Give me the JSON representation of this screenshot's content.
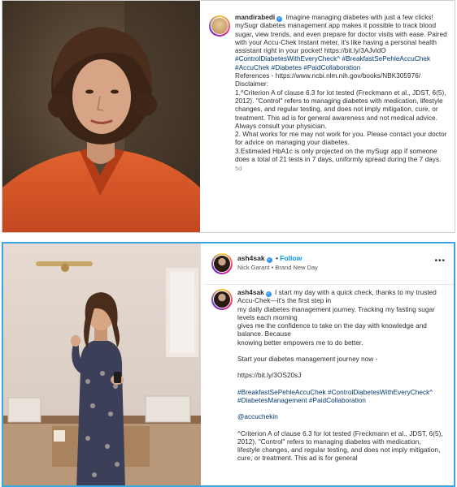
{
  "post1": {
    "username": "mandirabedi",
    "caption_intro": "Imagine managing diabetes with just a few clicks! mySugr diabetes management app makes it possible to track blood sugar, view trends, and even prepare for doctor visits with ease. Paired with your Accu-Chek Instant meter, it's like having a personal health assistant right in your pocket!",
    "link": "https://bit.ly/3AJvldO",
    "hashtags_line1": "#ControlDiabetesWithEveryCheck^ #BreakfastSePehleAccuChek",
    "hashtags_line2": "#AccuChek #Diabetes #PaidCollaboration",
    "references": "References - https://www.ncbi.nlm.nih.gov/books/NBK305976/",
    "disclaimer_label": "Disclaimer:",
    "disclaimer_1": "1.^Criterion A of clause 6.3 for lot tested (Freckmann et al., JDST, 6(5), 2012). \"Control\" refers to managing diabetes with medication, lifestyle changes, and regular testing, and does not imply mitigation, cure, or treatment. This ad is for general awareness and not medical advice. Always consult your physician.",
    "disclaimer_2": "2. What works for me may not work for you. Please contact your doctor for advice on managing your diabetes.",
    "disclaimer_3": "3.Estimated HbA1c is only projected on the mySugr app if someone does a total of 21 tests in 7 days, uniformly spread during the 7 days.",
    "time": "5d"
  },
  "post2": {
    "username": "ash4sak",
    "follow_label": "Follow",
    "dot": "•",
    "music": "Nick Garant • Brand New Day",
    "more": "•••",
    "caption_line1": "I start my day with a quick check, thanks to my trusted Accu-Chek—it's the first step in",
    "caption_line2": "my daily diabetes management journey. Tracking my fasting sugar levels each morning",
    "caption_line3": "gives me the confidence to take on the day with knowledge and balance. Because",
    "caption_line4": "knowing better empowers me to do better.",
    "start_text": "Start your diabetes management journey now -",
    "link": "https://bit.ly/3OS20sJ",
    "hashtags_line1": "#BreakfastSePehleAccuChek #ControlDiabetesWithEveryCheck^",
    "hashtags_line2": "#DiabetesManagement #PaidCollaboration",
    "mention": "@accuchekin",
    "disclaimer": "^Criterion A of clause 6.3 for lot tested (Freckmann et al., JDST, 6(5), 2012). \"Control\" refers to managing diabetes with medication, lifestyle changes, and regular testing, and does not imply mitigation, cure, or treatment. This ad is for general"
  },
  "colors": {
    "link_blue": "#0095f6",
    "hashtag": "#00376b",
    "frame_blue": "#39a7e0",
    "shirt_orange": "#d4542a"
  }
}
